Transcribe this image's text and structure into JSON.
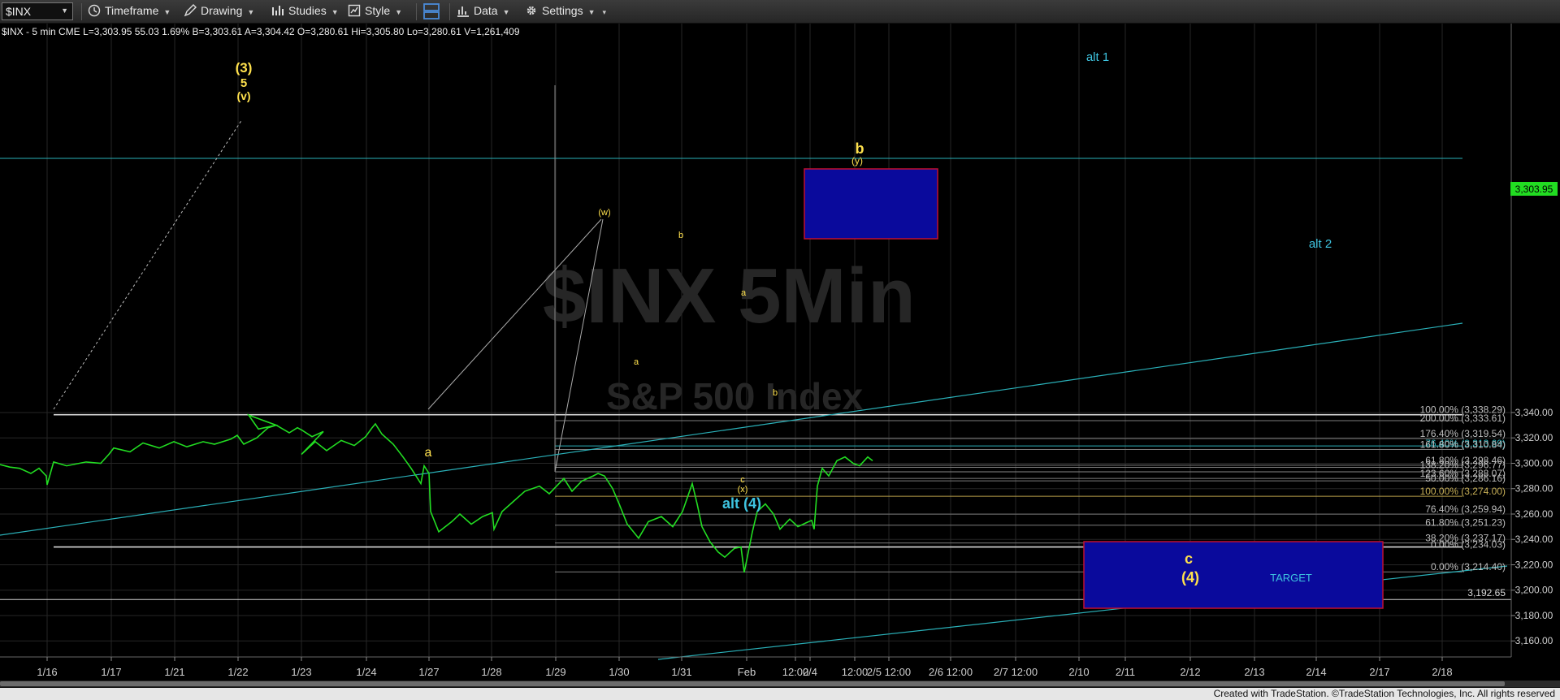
{
  "toolbar": {
    "symbol": "$INX",
    "timeframe": "Timeframe",
    "drawing": "Drawing",
    "studies": "Studies",
    "style": "Style",
    "data": "Data",
    "settings": "Settings"
  },
  "chart": {
    "header": "$INX - 5 min  CME  L=3,303.95  55.03  1.69%  B=3,303.61  A=3,304.42  O=3,280.61  Hi=3,305.80  Lo=3,280.61  V=1,261,409",
    "watermark_symbol": "$INX 5Min",
    "watermark_name": "S&P 500 Index",
    "last_price": "3,303.95",
    "footer": "Created with TradeStation. ©TradeStation Technologies, Inc. All rights reserved",
    "colors": {
      "price": "#22dd22",
      "wave_yellow": "#ffe14d",
      "wave_cyan": "#3ec4e0",
      "box_fill": "#0a0a9c",
      "box_border": "#c01030",
      "trend": "#2ab0b8"
    }
  },
  "chart_data": {
    "type": "line",
    "title": "",
    "xlabel": "",
    "ylabel": "",
    "ylim": [
      3148,
      3356
    ],
    "y_ticks": [
      3160,
      3180,
      3200,
      3220,
      3240,
      3260,
      3280,
      3300,
      3320,
      3340
    ],
    "y_tick_labels": [
      "3,160.00",
      "3,180.00",
      "3,200.00",
      "3,220.00",
      "3,240.00",
      "3,260.00",
      "3,280.00",
      "3,300.00",
      "3,320.00",
      "3,340.00"
    ],
    "x_ticks": [
      "1/16",
      "1/17",
      "1/21",
      "1/22",
      "1/23",
      "1/24",
      "1/27",
      "1/28",
      "1/29",
      "1/30",
      "1/31",
      "Feb",
      "12:00",
      "2/4",
      "12:00",
      "2/5 12:00",
      "2/6 12:00",
      "2/7 12:00",
      "2/10",
      "2/11",
      "2/12",
      "2/13",
      "2/14",
      "2/17",
      "2/18"
    ],
    "series": [
      {
        "values": [
          3299,
          3297,
          3296,
          3292,
          3296,
          3290,
          3283,
          3301,
          3298,
          3301,
          3300,
          3307,
          3312,
          3309,
          3316,
          3312,
          3317,
          3313,
          3317,
          3315,
          3319,
          3322,
          3315,
          3320,
          3328,
          3330,
          3338,
          3327,
          3330,
          3324,
          3328,
          3326,
          3321,
          3325,
          3307,
          3317,
          3310,
          3318,
          3314,
          3321,
          3328,
          3331,
          3323,
          3315,
          3305,
          3296,
          3288,
          3284,
          3298,
          3292,
          3262,
          3246,
          3254,
          3260,
          3252,
          3258,
          3261,
          3248,
          3262,
          3270,
          3278,
          3282,
          3276,
          3288,
          3278,
          3286,
          3290,
          3292,
          3290,
          3280,
          3268,
          3252,
          3241,
          3254,
          3258,
          3250,
          3262,
          3284,
          3268,
          3250,
          3238,
          3230,
          3226,
          3233,
          3234,
          3214,
          3246,
          3262,
          3268,
          3260,
          3248,
          3256,
          3250,
          3253,
          3255,
          3248,
          3282,
          3296,
          3290,
          3302,
          3305,
          3300,
          3298,
          3305,
          3302
        ]
      }
    ],
    "fib_levels": [
      {
        "label": "100.00% (3,338.29)",
        "value": 3338.29
      },
      {
        "label": "200.00% (3,333.61)",
        "value": 3333.61
      },
      {
        "label": "176.40% (3,319.54)",
        "value": 3319.54
      },
      {
        "label": "76.40% (3,313.69)",
        "value": 3313.69
      },
      {
        "label": "161.80% (3,310.84)",
        "value": 3310.84
      },
      {
        "label": "61.80% (3,298.46)",
        "value": 3298.46
      },
      {
        "label": "138.20% (3,296.77)",
        "value": 3296.77
      },
      {
        "label": "123.60% (3,288.07)",
        "value": 3288.07
      },
      {
        "label": "50.00% (3,286.16)",
        "value": 3286.16
      },
      {
        "label": "100.00% (3,274.00)",
        "value": 3274.0
      },
      {
        "label": "76.40% (3,259.94)",
        "value": 3259.94
      },
      {
        "label": "61.80% (3,251.23)",
        "value": 3251.23
      },
      {
        "label": "38.20% (3,237.17)",
        "value": 3237.17
      },
      {
        "label": "0.00% (3,234.03)",
        "value": 3234.03
      },
      {
        "label": "0.00% (3,214.40)",
        "value": 3214.4
      }
    ],
    "level_line": {
      "label": "3,192.65",
      "value": 3192.65
    },
    "wave_labels": [
      {
        "text": "(3)",
        "color": "yellow"
      },
      {
        "text": "5",
        "color": "yellow"
      },
      {
        "text": "(v)",
        "color": "yellow"
      },
      {
        "text": "a",
        "color": "yellow"
      },
      {
        "text": "(w)",
        "color": "yellow"
      },
      {
        "text": "a",
        "color": "yellow"
      },
      {
        "text": "b",
        "color": "yellow"
      },
      {
        "text": "a",
        "color": "yellow"
      },
      {
        "text": "b",
        "color": "yellow"
      },
      {
        "text": "c",
        "color": "yellow"
      },
      {
        "text": "(x)",
        "color": "yellow"
      },
      {
        "text": "alt (4)",
        "color": "cyan"
      },
      {
        "text": "b",
        "color": "yellow"
      },
      {
        "text": "(y)",
        "color": "yellow"
      },
      {
        "text": "alt 1",
        "color": "cyan"
      },
      {
        "text": "alt 2",
        "color": "cyan"
      },
      {
        "text": "c",
        "color": "yellow"
      },
      {
        "text": "(4)",
        "color": "yellow"
      },
      {
        "text": "TARGET",
        "color": "cyan"
      }
    ]
  }
}
